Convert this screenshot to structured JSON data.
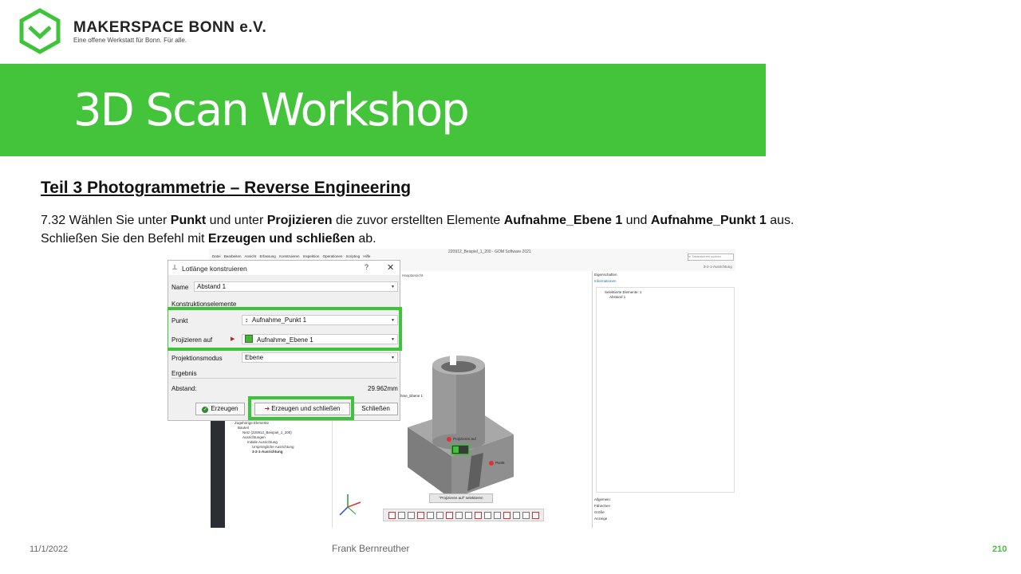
{
  "header": {
    "org_name": "MAKERSPACE BONN e.V.",
    "tagline": "Eine offene Werkstatt für Bonn. Für alle.",
    "banner_title": "3D Scan Workshop"
  },
  "colors": {
    "brand_green": "#44c43a",
    "highlight_green": "#3ec43b",
    "footer_green": "#4cb848"
  },
  "content": {
    "section_title": "Teil 3  Photogrammetrie  – Reverse Engineering",
    "line1": [
      {
        "t": "7.32 Wählen Sie unter ",
        "b": false
      },
      {
        "t": "Punkt",
        "b": true
      },
      {
        "t": " und unter ",
        "b": false
      },
      {
        "t": "Projizieren",
        "b": true
      },
      {
        "t": " die zuvor erstellten Elemente ",
        "b": false
      },
      {
        "t": "Aufnahme_Ebene 1",
        "b": true
      },
      {
        "t": " und ",
        "b": false
      },
      {
        "t": "Aufnahme_Punkt 1",
        "b": true
      },
      {
        "t": " aus.",
        "b": false
      }
    ],
    "line2": [
      {
        "t": "Schließen Sie den Befehl mit ",
        "b": false
      },
      {
        "t": "Erzeugen und schließen",
        "b": true
      },
      {
        "t": " ab.",
        "b": false
      }
    ]
  },
  "screenshot": {
    "app_title": "220912_Beispiel_1_200 - GOM Software 2021",
    "menu": "Datei Bearbeiten Ansicht Erfassung Konstruieren Inspektion Operationen Scripting Hilfe",
    "search_placeholder": "In Tastenkürzel suchen",
    "gom_logo": "gom",
    "alignment_label": "3-2-1-Ausrichtung",
    "viewport_tab": "Hauptansicht",
    "tree": [
      "Zugehörige Elemente",
      "Bauteil",
      "Netz (220912_Beispiel_1_200)",
      "Ausrichtungen",
      "Initiale Ausrichtung",
      "Ursprüngliche Ausrichtung",
      "3-2-1-Ausrichtung"
    ],
    "right_panel": {
      "header": "Eigenschaften",
      "info": "Informationen",
      "selected": "Selektierte Elemente: 1",
      "item": "Abstand 1",
      "footer": [
        "Allgemein",
        "Fähnchen",
        "Größe",
        "Anzeige"
      ]
    },
    "viewport_labels": {
      "plane": "hme_Ebene 1",
      "projected": "Projizieren auf",
      "point": "Punkt",
      "select_hint": "\"Projizieren auf\" selektieren"
    },
    "dialog": {
      "title": "Lotlänge konstruieren",
      "help": "?",
      "close": "✕",
      "name_label": "Name",
      "name_value": "Abstand 1",
      "section_construction": "Konstruktionselemente",
      "point_label": "Punkt",
      "point_value": "Aufnahme_Punkt 1",
      "project_label": "Projizieren auf",
      "project_value": "Aufnahme_Ebene 1",
      "mode_label": "Projektionsmodus",
      "mode_value": "Ebene",
      "section_result": "Ergebnis",
      "distance_label": "Abstand:",
      "distance_value": "29.962mm",
      "btn_create": "Erzeugen",
      "btn_create_close": "Erzeugen und schließen",
      "btn_close": "Schließen"
    }
  },
  "footer": {
    "date": "11/1/2022",
    "author": "Frank Bernreuther",
    "page": "210"
  }
}
